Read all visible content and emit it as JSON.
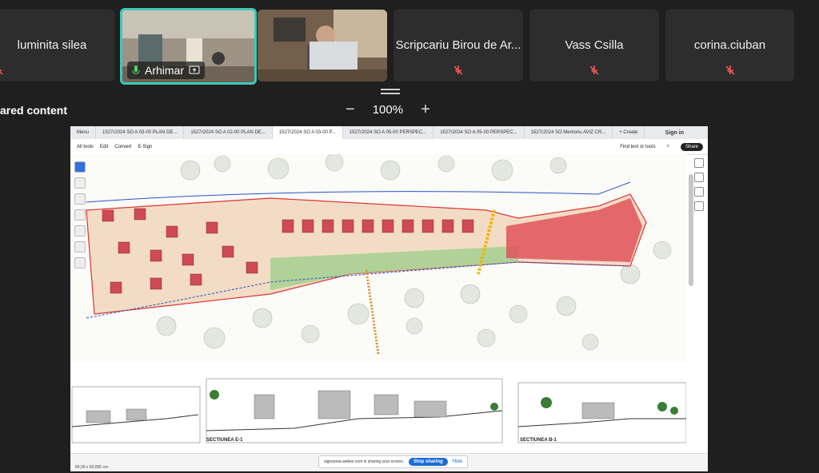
{
  "participants": [
    {
      "name": "luminita silea",
      "muted": true
    },
    {
      "name": "Arhimar",
      "muted": false,
      "video": true,
      "active": true
    },
    {
      "name": "",
      "muted": false,
      "video": true
    },
    {
      "name": "Scripcariu Birou de Ar...",
      "muted": true
    },
    {
      "name": "Vass Csilla",
      "muted": true
    },
    {
      "name": "corina.ciuban",
      "muted": true
    }
  ],
  "shared_label": "ared content",
  "zoom": {
    "minus": "−",
    "value": "100%",
    "plus": "+"
  },
  "browser": {
    "tabs": [
      "Menu",
      "1527r2024 SO A 03-00 PLAN DE...",
      "1527r2024 SO A 02-00 PLAN DE...",
      "1527r2024 SO A 03-00 P...",
      "1527r2024 SO A 05-00 PERSPEC...",
      "1527r2024 SO A 05-00 PERSPEC...",
      "1527r2024 SO Memoriu AVIZ CR...",
      "+ Create"
    ],
    "signin": "Sign in",
    "menu": [
      "All tools",
      "Edit",
      "Convert",
      "E-Sign"
    ],
    "find": "Find text or tools",
    "share": "Share"
  },
  "sections": {
    "e1": "SECTIUNEA E-1",
    "b1": "SECTIUNEA B-1"
  },
  "sharing": {
    "message": "signsorea.webex.com is sharing your screen.",
    "stop": "Stop sharing",
    "hide": "Hide"
  },
  "status": {
    "coords": "84,00 x 59,055 cm"
  },
  "colors": {
    "accent": "#3ec8b8",
    "stop": "#1a6dd6"
  }
}
